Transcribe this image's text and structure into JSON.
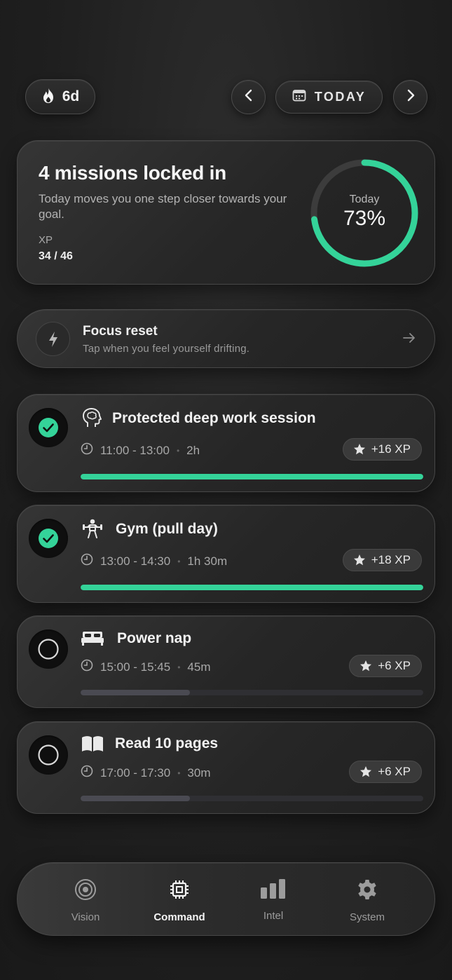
{
  "header": {
    "streak_label": "6d",
    "today_label": "TODAY"
  },
  "summary": {
    "title": "4 missions locked in",
    "subtitle": "Today moves you one step closer towards your goal.",
    "xp_label": "XP",
    "xp_value": "34 / 46",
    "ring_label": "Today",
    "ring_percent_text": "73%",
    "ring_progress": 0.73,
    "accent_color": "#34d399"
  },
  "focus": {
    "title": "Focus reset",
    "subtitle": "Tap when you feel yourself drifting."
  },
  "tasks": [
    {
      "name": "Protected deep work session",
      "icon": "brain-head-icon",
      "time": "11:00 - 13:00",
      "duration": "2h",
      "xp": "+16 XP",
      "done": true,
      "progress": 1.0
    },
    {
      "name": "Gym (pull day)",
      "icon": "weightlifter-icon",
      "time": "13:00 - 14:30",
      "duration": "1h 30m",
      "xp": "+18 XP",
      "done": true,
      "progress": 1.0
    },
    {
      "name": "Power nap",
      "icon": "bed-icon",
      "time": "15:00 - 15:45",
      "duration": "45m",
      "xp": "+6 XP",
      "done": false,
      "progress": 0.32
    },
    {
      "name": "Read 10 pages",
      "icon": "book-icon",
      "time": "17:00 - 17:30",
      "duration": "30m",
      "xp": "+6 XP",
      "done": false,
      "progress": 0.32
    }
  ],
  "nav": {
    "tabs": [
      {
        "label": "Vision",
        "icon": "target-icon",
        "active": false
      },
      {
        "label": "Command",
        "icon": "chip-icon",
        "active": true
      },
      {
        "label": "Intel",
        "icon": "bar-chart-icon",
        "active": false
      },
      {
        "label": "System",
        "icon": "gear-icon",
        "active": false
      }
    ]
  }
}
